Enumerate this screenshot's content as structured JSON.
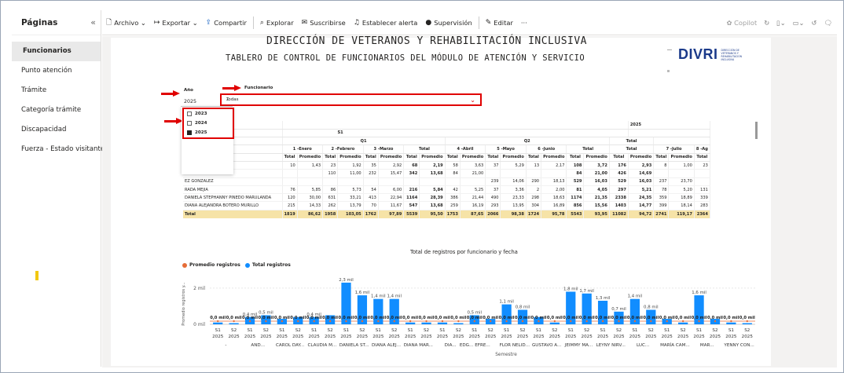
{
  "pages_pane": {
    "title": "Páginas",
    "collapse_glyph": "«",
    "items": [
      "Funcionarios",
      "Punto atención",
      "Trámite",
      "Categoría trámite",
      "Discapacidad",
      "Fuerza - Estado visitante"
    ],
    "active_index": 0
  },
  "toolbar": {
    "file": "Archivo",
    "export": "Exportar",
    "share": "Compartir",
    "explore": "Explorar",
    "subscribe": "Suscribirse",
    "alert": "Establecer alerta",
    "supervision": "Supervisión",
    "edit": "Editar",
    "more": "···",
    "copilot": "Copilot"
  },
  "report": {
    "title_line1": "DIRECCIÓN DE VETERANOS Y REHABILITACIÓN INCLUSIVA",
    "title_line2": "TABLERO DE CONTROL DE FUNCIONARIOS DEL MÓDULO DE ATENCIÓN Y SERVICIO",
    "logo_text": "DIVRI",
    "logo_subtext": "DIRECCIÓN DE VETERANOS Y REHABILITACIÓN INCLUSIVA"
  },
  "slicers": {
    "year_label": "Año",
    "year_value": "2025",
    "year_options": [
      {
        "label": "2023",
        "checked": false
      },
      {
        "label": "2024",
        "checked": false
      },
      {
        "label": "2025",
        "checked": true
      }
    ],
    "funcionario_label": "Funcionario",
    "funcionario_value": "Todas"
  },
  "matrix": {
    "year_top": "2025",
    "semester": "S1",
    "quarter": "Q1",
    "quarter2": "Q2",
    "total_label": "Total",
    "row_headers": [
      "o",
      "stre",
      "stre",
      "s",
      "Publico"
    ],
    "months": [
      "1 -Enero",
      "2 -Febrero",
      "3 -Marzo",
      "Total",
      "4 -Abril",
      "5 -Mayo",
      "6 -Junio",
      "Total",
      "Total",
      "7 -Julio",
      "8 -Ag"
    ],
    "sub": [
      "Total",
      "Promedio",
      "Total",
      "Promedio",
      "Total",
      "Promedio",
      "Total",
      "Promedio",
      "Total",
      "Promedio",
      "Total",
      "Promedio",
      "Total",
      "Promedio",
      "Total",
      "Promedio",
      "Total",
      "Promedio",
      "Total",
      "Promedio",
      "Total",
      "Pr"
    ],
    "rows": [
      [
        "",
        "10",
        "1,43",
        "23",
        "1,92",
        "35",
        "2,92",
        "68",
        "2,19",
        "58",
        "3,63",
        "37",
        "5,29",
        "13",
        "2,17",
        "108",
        "3,72",
        "176",
        "2,93",
        "8",
        "1,00",
        "23"
      ],
      [
        "ANCHEZ",
        "",
        "",
        "110",
        "11,00",
        "232",
        "15,47",
        "342",
        "13,68",
        "84",
        "21,00",
        "",
        "",
        "",
        "",
        "84",
        "21,00",
        "426",
        "14,69",
        "",
        "",
        ""
      ],
      [
        "EZ GONZALEZ",
        "",
        "",
        "",
        "",
        "",
        "",
        "",
        "",
        "",
        "",
        "239",
        "14,06",
        "290",
        "18,13",
        "529",
        "16,03",
        "529",
        "16,03",
        "237",
        "23,70",
        ""
      ],
      [
        "RADA MEJIA",
        "76",
        "5,85",
        "86",
        "5,73",
        "54",
        "6,00",
        "216",
        "5,84",
        "42",
        "5,25",
        "37",
        "3,36",
        "2",
        "2,00",
        "81",
        "4,05",
        "297",
        "5,21",
        "78",
        "5,20",
        "131"
      ],
      [
        "DANIELA STEPHANNY PINEDO MARULANDA",
        "120",
        "30,00",
        "631",
        "33,21",
        "413",
        "22,94",
        "1164",
        "28,39",
        "386",
        "21,44",
        "490",
        "23,33",
        "298",
        "18,63",
        "1174",
        "21,35",
        "2338",
        "24,35",
        "359",
        "18,89",
        "339"
      ],
      [
        "DIANA ALEJANDRA BOTERO MURILLO",
        "215",
        "14,33",
        "262",
        "13,79",
        "70",
        "11,67",
        "547",
        "13,68",
        "259",
        "16,19",
        "293",
        "13,95",
        "304",
        "16,89",
        "856",
        "15,56",
        "1403",
        "14,77",
        "399",
        "18,14",
        "283"
      ]
    ],
    "total_row": [
      "Total",
      "1819",
      "86,62",
      "1958",
      "103,05",
      "1762",
      "97,89",
      "5539",
      "95,50",
      "1753",
      "87,65",
      "2066",
      "98,38",
      "1724",
      "95,78",
      "5543",
      "93,95",
      "11082",
      "94,72",
      "2741",
      "119,17",
      "2364"
    ]
  },
  "chart_data": {
    "type": "bar",
    "title": "Total de registros por funcionario y fecha",
    "legend": [
      {
        "name": "Promedio registros",
        "color": "#e66c37"
      },
      {
        "name": "Total registros",
        "color": "#118dff"
      }
    ],
    "ylabel": "Promedio registros y...",
    "xlabel": "Semestre",
    "y_ticks": [
      "2 mil",
      "0 mil"
    ],
    "ylim": [
      0,
      2.6
    ],
    "avg_label": "0,0 mil",
    "categories": [
      {
        "sem": "S1",
        "year": "2025",
        "func": "-"
      },
      {
        "sem": "S2",
        "year": "2025",
        "func": ""
      },
      {
        "sem": "S1",
        "year": "2025",
        "func": "AND..."
      },
      {
        "sem": "S2",
        "year": "2025",
        "func": ""
      },
      {
        "sem": "S1",
        "year": "2025",
        "func": "CAROL DAY..."
      },
      {
        "sem": "S2",
        "year": "2025",
        "func": ""
      },
      {
        "sem": "S1",
        "year": "2025",
        "func": "CLAUDIA M..."
      },
      {
        "sem": "S2",
        "year": "2025",
        "func": ""
      },
      {
        "sem": "S1",
        "year": "2025",
        "func": "DANIELA ST..."
      },
      {
        "sem": "S2",
        "year": "2025",
        "func": ""
      },
      {
        "sem": "S1",
        "year": "2025",
        "func": "DIANA ALEJ..."
      },
      {
        "sem": "S2",
        "year": "2025",
        "func": ""
      },
      {
        "sem": "S1",
        "year": "2025",
        "func": "DIANA MAR..."
      },
      {
        "sem": "S2",
        "year": "2025",
        "func": ""
      },
      {
        "sem": "S1",
        "year": "2025",
        "func": "DIA..."
      },
      {
        "sem": "S2",
        "year": "2025",
        "func": "EDG..."
      },
      {
        "sem": "S1",
        "year": "2025",
        "func": "EFRE..."
      },
      {
        "sem": "S2",
        "year": "2025",
        "func": ""
      },
      {
        "sem": "S1",
        "year": "2025",
        "func": "FLOR NELID..."
      },
      {
        "sem": "S2",
        "year": "2025",
        "func": ""
      },
      {
        "sem": "S1",
        "year": "2025",
        "func": "GUSTAVO A..."
      },
      {
        "sem": "S2",
        "year": "2025",
        "func": ""
      },
      {
        "sem": "S1",
        "year": "2025",
        "func": "JEIMMY MA..."
      },
      {
        "sem": "S2",
        "year": "2025",
        "func": ""
      },
      {
        "sem": "S1",
        "year": "2025",
        "func": "LEYNY NIRV..."
      },
      {
        "sem": "S2",
        "year": "2025",
        "func": ""
      },
      {
        "sem": "S1",
        "year": "2025",
        "func": "LUC..."
      },
      {
        "sem": "S2",
        "year": "2025",
        "func": ""
      },
      {
        "sem": "S1",
        "year": "2025",
        "func": "MARÍA CAM..."
      },
      {
        "sem": "S2",
        "year": "2025",
        "func": ""
      },
      {
        "sem": "S1",
        "year": "2025",
        "func": "MAR..."
      },
      {
        "sem": "S2",
        "year": "2025",
        "func": ""
      },
      {
        "sem": "S1",
        "year": "2025",
        "func": "YENNY CON..."
      },
      {
        "sem": "S2",
        "year": "2025",
        "func": ""
      }
    ],
    "values": [
      0.1,
      0.05,
      0.4,
      0.5,
      0.3,
      0.4,
      0.4,
      0.5,
      2.3,
      1.6,
      1.4,
      1.4,
      0.1,
      0.1,
      0.1,
      0.05,
      0.5,
      0.3,
      1.1,
      0.8,
      0.4,
      0.1,
      1.8,
      1.7,
      1.3,
      0.7,
      1.4,
      0.8,
      0.3,
      0.1,
      1.6,
      0.3,
      0.1,
      0.05
    ],
    "value_labels": [
      "",
      "",
      "0,4 mil",
      "0,5 mil",
      "",
      "",
      "0,4 mil",
      "",
      "2,3 mil",
      "1,6 mil",
      "1,4 mil",
      "1,4 mil",
      "",
      "",
      "",
      "",
      "0,5 mil",
      "",
      "1,1 mil",
      "0,8 mil",
      "",
      "",
      "1,8 mil",
      "1,7 mil",
      "1,3 mil",
      "0,7 mil",
      "1,4 mil",
      "0,8 mil",
      "",
      "",
      "1,6 mil",
      "",
      "",
      ""
    ]
  }
}
